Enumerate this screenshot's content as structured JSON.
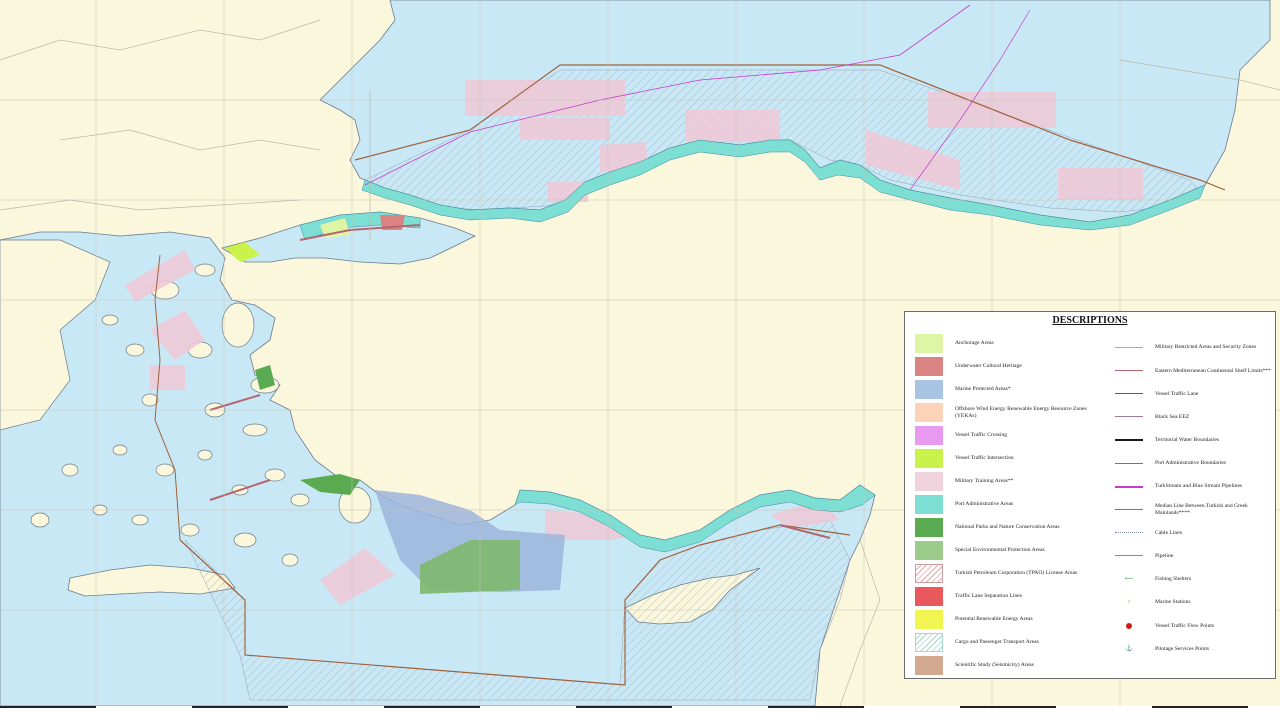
{
  "legend": {
    "title": "DESCRIPTIONS",
    "areas": [
      {
        "label": "Anchorage Areas",
        "color": "#ddf5a4",
        "style": "fill"
      },
      {
        "label": "Underwater Cultural Heritage",
        "color": "#d98383",
        "style": "fill"
      },
      {
        "label": "Marine Protected Areas*",
        "color": "#a9c4e3",
        "style": "fill"
      },
      {
        "label": "Offshore Wind Energy Renewable Energy Resource Zones (YEKAs)",
        "color": "#fcd3b9",
        "style": "fill"
      },
      {
        "label": "Vessel Traffic Crossing",
        "color": "#e89af0",
        "style": "fill"
      },
      {
        "label": "Vessel Traffic Intersection",
        "color": "#c9f24a",
        "style": "fill"
      },
      {
        "label": "Military Training Areas**",
        "color": "#f0d3dc",
        "style": "fill"
      },
      {
        "label": "Port Administrative Areas",
        "color": "#7ddfd3",
        "style": "fill"
      },
      {
        "label": "National Parks and Nature Conservation Areas",
        "color": "#5aaa52",
        "style": "fill"
      },
      {
        "label": "Special Environmental Protection Areas",
        "color": "#9ccb8c",
        "style": "fill"
      },
      {
        "label": "Turkish Petroleum Corporation (TPAO) License Areas",
        "color": "#e1a8a8",
        "style": "hatch"
      },
      {
        "label": "Traffic Lane Separation Lines",
        "color": "#e8585c",
        "style": "fill"
      },
      {
        "label": "Potential Renewable Energy Areas",
        "color": "#f0f552",
        "style": "fill"
      },
      {
        "label": "Cargo and Passenger Transport Areas",
        "color": "#a9d6cf",
        "style": "hatch2"
      },
      {
        "label": "Scientific Study (Seismicity) Areas",
        "color": "#d2a890",
        "style": "fill"
      }
    ],
    "lines": [
      {
        "label": "Military Restricted Areas and Security Zones",
        "color": "#d58ad8",
        "kind": "solid",
        "width": 1
      },
      {
        "label": "Eastern Mediterranean Continental Shelf Limits***",
        "color": "#b5656f",
        "kind": "solid",
        "width": 1
      },
      {
        "label": "Vessel Traffic Lane",
        "color": "#556070",
        "kind": "solid",
        "width": 1
      },
      {
        "label": "Black Sea EEZ",
        "color": "#a07898",
        "kind": "solid",
        "width": 1
      },
      {
        "label": "Territorial Water Boundaries",
        "color": "#1a1a1a",
        "kind": "solid",
        "width": 2
      },
      {
        "label": "Port Administrative Boundaries",
        "color": "#3a8aa0",
        "kind": "solid",
        "width": 1
      },
      {
        "label": "TurkStream and Blue Stream Pipelines",
        "color": "#c53cc8",
        "kind": "solid",
        "width": 2
      },
      {
        "label": "Median Line Between Turkish and Greek Mainlands****",
        "color": "#9a6b55",
        "kind": "solid",
        "width": 1
      },
      {
        "label": "Cable Lines",
        "color": "#7a8aa8",
        "kind": "dotted",
        "width": 1
      },
      {
        "label": "Pipeline",
        "color": "#5e9ca0",
        "kind": "solid",
        "width": 1
      }
    ],
    "points": [
      {
        "label": "Fishing Shelters",
        "color": "#3aa040",
        "symbol": "⟵"
      },
      {
        "label": "Marine Stations",
        "color": "#d1a017",
        "symbol": "?"
      },
      {
        "label": "Vessel Traffic Flow Points",
        "color": "#d11a1a",
        "symbol": "dot"
      },
      {
        "label": "Pilotage Services Points",
        "color": "#5e8ad0",
        "symbol": "⚓"
      }
    ]
  },
  "map_colors": {
    "sea": "#c9e8f6",
    "land": "#fbf7dc",
    "coast": "#6a7a8a",
    "port": "#7ddfd3",
    "military": "#f0c8d6",
    "eez": "#a0623c"
  }
}
